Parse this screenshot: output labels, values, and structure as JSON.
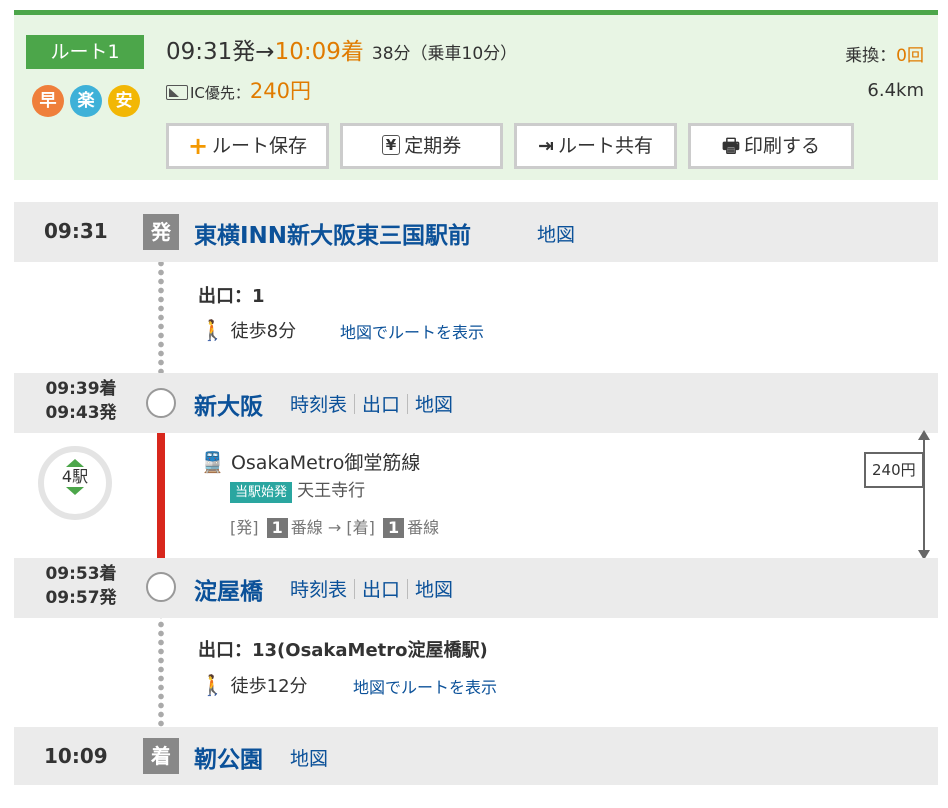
{
  "summary": {
    "route_label": "ルート1",
    "features": [
      {
        "label": "早",
        "color": "#ef7f3b"
      },
      {
        "label": "楽",
        "color": "#3eb1d8"
      },
      {
        "label": "安",
        "color": "#f2b705"
      }
    ],
    "depart_time": "09:31発",
    "arrow": "→",
    "arrive_time": "10:09着",
    "duration": "38分（乗車10分）",
    "ic_label": "IC優先：",
    "fare": "240円",
    "transfer_label": "乗換：",
    "transfer_count": "0回",
    "distance": "6.4km",
    "buttons": {
      "save": "ルート保存",
      "commuter": "定期券",
      "share": "ルート共有",
      "print": "印刷する"
    }
  },
  "stops": {
    "origin": {
      "time": "09:31",
      "tag": "発",
      "name": "東横INN新大阪東三国駅前",
      "map": "地図"
    },
    "shin_osaka": {
      "arr": "09:39着",
      "dep": "09:43発",
      "name": "新大阪",
      "timetable": "時刻表",
      "exit": "出口",
      "map": "地図"
    },
    "yodoyabashi": {
      "arr": "09:53着",
      "dep": "09:57発",
      "name": "淀屋橋",
      "timetable": "時刻表",
      "exit": "出口",
      "map": "地図"
    },
    "destination": {
      "time": "10:09",
      "tag": "着",
      "name": "靭公園",
      "map": "地図"
    }
  },
  "walk1": {
    "exit": "出口：1",
    "walk": "徒歩8分",
    "link": "地図でルートを表示"
  },
  "ride": {
    "line": "OsakaMetro御堂筋線",
    "start_badge": "当駅始発",
    "direction": "天王寺行",
    "dep_label": "[発]",
    "dep_platform": "1",
    "track_suffix": "番線",
    "to": "→",
    "arr_label": "[着]",
    "arr_platform": "1",
    "stops_count": "4駅",
    "fare": "240円"
  },
  "walk2": {
    "exit": "出口：13(OsakaMetro淀屋橋駅)",
    "walk": "徒歩12分",
    "link": "地図でルートを表示"
  }
}
